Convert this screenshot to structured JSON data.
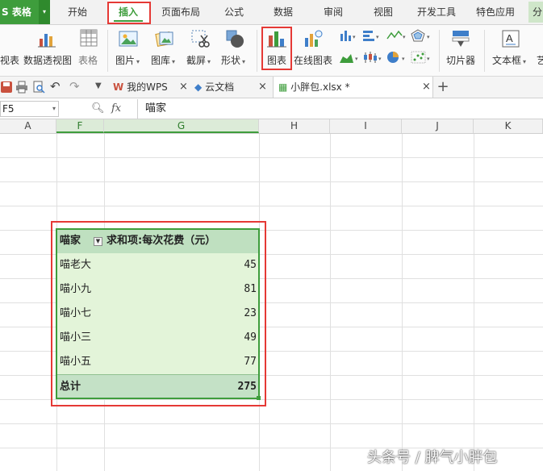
{
  "app": {
    "logo_label": "S 表格"
  },
  "menu": {
    "tabs": [
      "开始",
      "插入",
      "页面布局",
      "公式",
      "数据",
      "审阅",
      "视图",
      "开发工具",
      "特色应用"
    ],
    "active_tab": "插入",
    "tail": "分"
  },
  "ribbon": {
    "items": {
      "cut_left": "视表",
      "pivot": "数据透视图",
      "table": "表格",
      "picture": "图片",
      "gallery": "图库",
      "screenshot": "截屏",
      "shapes": "形状",
      "chart": "图表",
      "online_chart": "在线图表",
      "slicer": "切片器",
      "textbox": "文本框",
      "cut_right": "艺"
    }
  },
  "tabs_bar": {
    "tabs": [
      "我的WPS",
      "云文档",
      "小胖包.xlsx *"
    ],
    "new_tab": "+"
  },
  "formula_bar": {
    "name_box": "F5",
    "fx": "fx",
    "content": "喵家"
  },
  "columns": [
    "A",
    "F",
    "G",
    "H",
    "I",
    "J",
    "K"
  ],
  "pivot": {
    "header_row_label": "喵家",
    "header_value_label": "求和项:每次花费（元）",
    "rows": [
      {
        "name": "喵老大",
        "value": 45
      },
      {
        "name": "喵小九",
        "value": 81
      },
      {
        "name": "喵小七",
        "value": 23
      },
      {
        "name": "喵小三",
        "value": 49
      },
      {
        "name": "喵小五",
        "value": 77
      }
    ],
    "total_label": "总计",
    "total_value": 275
  },
  "watermark": "头条号 / 脾气小胖包",
  "colors": {
    "accent": "#3e9d3c",
    "highlight": "#e53935",
    "pivot_body": "#e3f4d9",
    "pivot_header": "#bfe0c0"
  }
}
